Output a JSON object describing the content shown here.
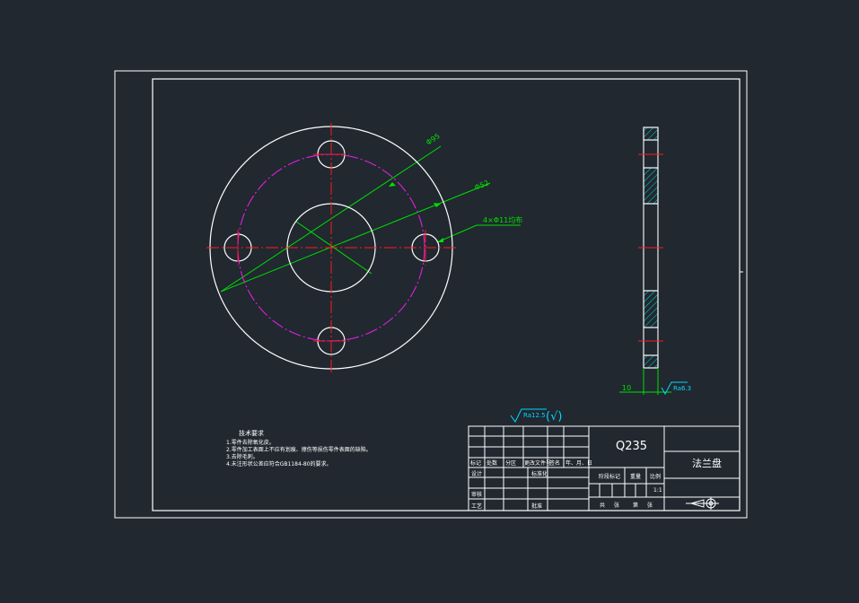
{
  "colors": {
    "background": "#212830",
    "line": "#ffffff",
    "centerline": "#ff1a1a",
    "dimension": "#00e000",
    "pitch_circle": "#e020e0",
    "hatch": "#00d8d8",
    "roughness": "#00d8ff"
  },
  "part_view": {
    "dim_outer": "Φ95",
    "dim_pitch": "Φ52",
    "dim_holes": "4×Φ11均布",
    "dim_thickness": "10",
    "roughness_side": "Ra6.3",
    "roughness_general": "Ra12.5",
    "roughness_general_suffix": "(√)"
  },
  "tech_requirements": {
    "title": "技术要求",
    "items": [
      "1.零件去除氧化皮。",
      "2.零件加工表面上不应有划痕、擦伤等损伤零件表面的缺陷。",
      "3.去除毛刺。",
      "4.未注形状公差应符合GB1184-80的要求。"
    ]
  },
  "title_block": {
    "material": "Q235",
    "part_name": "法兰盘",
    "header_row": [
      "标记",
      "处数",
      "分区",
      "更改文件号",
      "签名",
      "年、月、日"
    ],
    "design_row": [
      "设计",
      "",
      "标准化",
      ""
    ],
    "review_row": [
      "审核"
    ],
    "process_row": [
      "工艺",
      "",
      "批准"
    ],
    "stage_labels": [
      "阶段标记",
      "重量",
      "比例"
    ],
    "scale": "1:1",
    "sheets": [
      "共",
      "张",
      "第",
      "张"
    ]
  }
}
